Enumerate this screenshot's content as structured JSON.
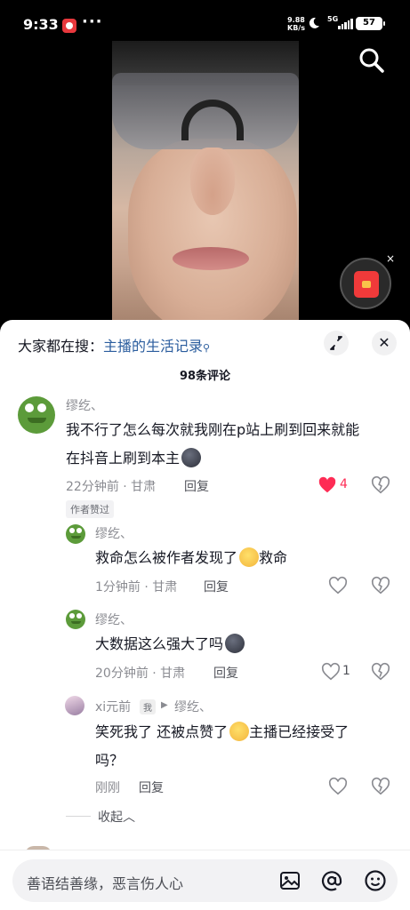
{
  "status_bar": {
    "time": "9:33",
    "dots": "···",
    "speed_value": "9.88",
    "speed_unit": "KB/s",
    "network": "5G",
    "battery": "57"
  },
  "video": {
    "search_icon": "search-icon",
    "redpacket_icon": "red-envelope-icon",
    "close_glyph": "×"
  },
  "sheet": {
    "hot_search_prefix": "大家都在搜：",
    "hot_search_query": "主播的生活记录",
    "count": "98条评论",
    "close_glyph": "✕"
  },
  "comments": [
    {
      "user": "缪纥、",
      "text_line1": "我不行了怎么每次就我刚在p站上刷到回来就能",
      "text_line2": "在抖音上刷到本主",
      "time": "22分钟前 · 甘肃",
      "reply": "回复",
      "likes": "4",
      "liked": true,
      "tag": "作者赞过",
      "replies": [
        {
          "user": "缪纥、",
          "text": "救命怎么被作者发现了",
          "text_after": "救命",
          "time": "1分钟前 · 甘肃",
          "reply": "回复",
          "likes": ""
        },
        {
          "user": "缪纥、",
          "text": "大数据这么强大了吗",
          "time": "20分钟前 · 甘肃",
          "reply": "回复",
          "likes": "1"
        },
        {
          "user": "xi元前",
          "me_tag": "我",
          "reply_to": "缪纥、",
          "text_line1": "笑死我了 还被点赞了",
          "text_line1_after": "主播已经接受了",
          "text_line2": "吗？",
          "time": "刚刚",
          "reply": "回复",
          "likes": ""
        }
      ]
    }
  ],
  "collapse_label": "收起︿",
  "input": {
    "placeholder": "善语结善缘，恶言伤人心",
    "icons": [
      "image-icon",
      "at-icon",
      "emoji-icon"
    ]
  },
  "colors": {
    "like_red": "#fe2c55",
    "link_blue": "#2b5d9e"
  }
}
